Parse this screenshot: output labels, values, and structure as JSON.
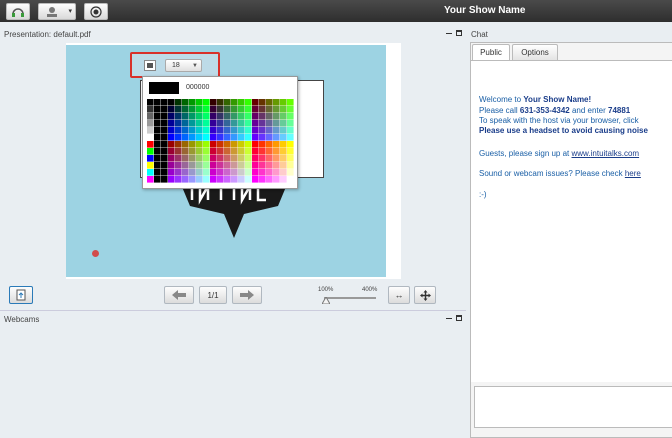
{
  "app": {
    "show_name": "Your Show Name"
  },
  "presentation": {
    "header": "Presentation: default.pdf",
    "font_size": "18",
    "hex_value": "000000",
    "page_indicator": "1/1",
    "zoom_min": "100%",
    "zoom_max": "400%",
    "zoom_level": 0.0
  },
  "webcams": {
    "header": "Webcams"
  },
  "chat": {
    "header": "Chat",
    "tabs": [
      "Public",
      "Options"
    ],
    "welcome_prefix": "Welcome to ",
    "welcome_name": "Your Show Name!",
    "call_prefix": " Please call ",
    "call_number": "631-353-4342",
    "call_suffix": " and enter ",
    "call_code": "74881",
    "speak_text": "To speak with the host via your browser, click",
    "headset_text": "Please use a headset to avoid causing noise",
    "guests_prefix": "Guests, please sign up at ",
    "guests_link": "www.intuitalks.com",
    "issues_prefix": "Sound or webcam issues? Please check ",
    "issues_link": "here",
    "smiley": ":-)"
  },
  "colors": {
    "accent_red": "#d8302a",
    "slide_bg": "#9dd3e3",
    "chat_text": "#1a5fa6"
  }
}
